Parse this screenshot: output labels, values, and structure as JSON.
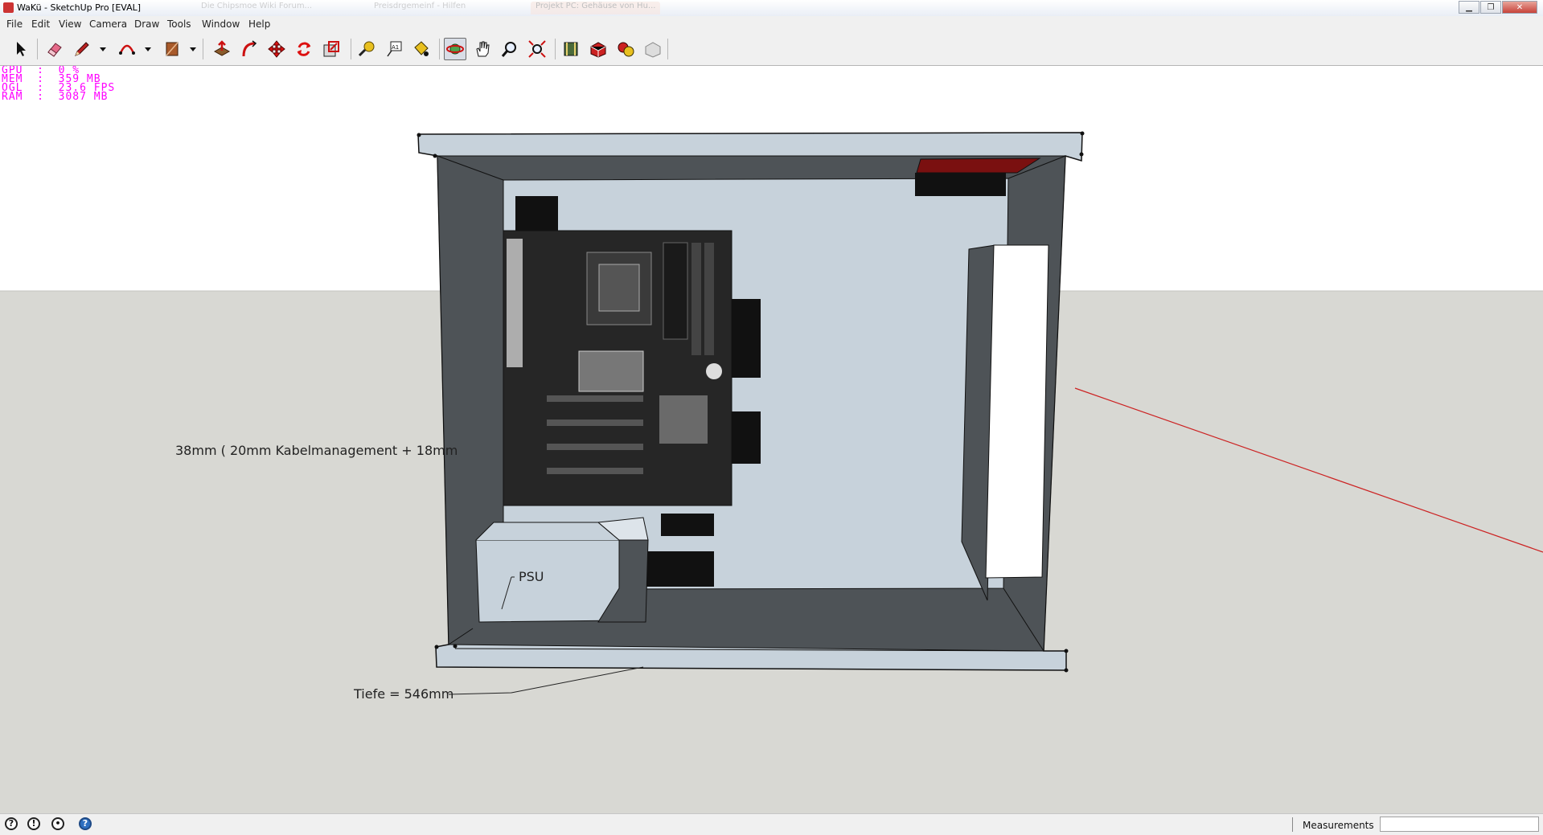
{
  "window": {
    "title": "WaKü - SketchUp Pro [EVAL]",
    "background_tabs": [
      "Die Chipsmoe Wiki Forum...",
      "Preisdrgemeinf - Hilfen",
      "Projekt PC: Gehäuse von Hu..."
    ],
    "controls": {
      "minimize": "▁",
      "maximize": "❐",
      "close": "✕"
    }
  },
  "menu": [
    "File",
    "Edit",
    "View",
    "Camera",
    "Draw",
    "Tools",
    "Window",
    "Help"
  ],
  "toolbar": {
    "tools": [
      {
        "name": "select-tool",
        "icon": "arrow-cursor-icon"
      },
      {
        "name": "eraser-tool",
        "icon": "eraser-icon"
      },
      {
        "name": "pencil-tool",
        "icon": "pencil-icon",
        "dropdown": true
      },
      {
        "name": "arc-tool",
        "icon": "arc-icon",
        "dropdown": true
      },
      {
        "name": "rectangle-tool",
        "icon": "rectangle-icon",
        "dropdown": true
      },
      {
        "name": "push-pull-tool",
        "icon": "push-pull-icon"
      },
      {
        "name": "follow-me-tool",
        "icon": "follow-me-icon"
      },
      {
        "name": "move-tool",
        "icon": "move-icon"
      },
      {
        "name": "rotate-tool",
        "icon": "rotate-icon"
      },
      {
        "name": "scale-tool",
        "icon": "scale-icon"
      },
      {
        "name": "tape-measure-tool",
        "icon": "tape-measure-icon"
      },
      {
        "name": "text-tool",
        "icon": "text-icon"
      },
      {
        "name": "paint-bucket-tool",
        "icon": "paint-bucket-icon"
      },
      {
        "name": "orbit-tool",
        "icon": "orbit-icon",
        "active": true
      },
      {
        "name": "pan-tool",
        "icon": "hand-icon"
      },
      {
        "name": "zoom-tool",
        "icon": "magnifier-icon"
      },
      {
        "name": "zoom-extents-tool",
        "icon": "zoom-extents-icon"
      },
      {
        "name": "3d-warehouse-tool",
        "icon": "warehouse-icon"
      },
      {
        "name": "share-model-tool",
        "icon": "share-model-icon"
      },
      {
        "name": "components-tool",
        "icon": "components-icon"
      },
      {
        "name": "extension-tool",
        "icon": "extension-icon"
      }
    ],
    "text_tool_glyph": "A1"
  },
  "stats_overlay": [
    {
      "key": "GPU",
      "value": "0 %"
    },
    {
      "key": "MEM",
      "value": "359 MB"
    },
    {
      "key": "OGL",
      "value": "23.6 FPS"
    },
    {
      "key": "RAM",
      "value": "3087 MB"
    }
  ],
  "model_labels": {
    "side_dimension": "38mm ( 20mm Kabelmanagement + 18mm",
    "psu": "PSU",
    "depth": "Tiefe = 546mm"
  },
  "colors": {
    "sky": "#ffffff",
    "ground": "#d8d8d3",
    "case_panel": "#c7d2db",
    "case_wall": "#4e5357",
    "red_axis": "#cc2222",
    "stats": "#ff00ff",
    "radiator_red": "#7a1010"
  },
  "statusbar": {
    "icons": [
      "geo-location-icon",
      "credits-icon",
      "user-icon",
      "help-icon"
    ],
    "measurements_label": "Measurements",
    "measurements_value": ""
  }
}
